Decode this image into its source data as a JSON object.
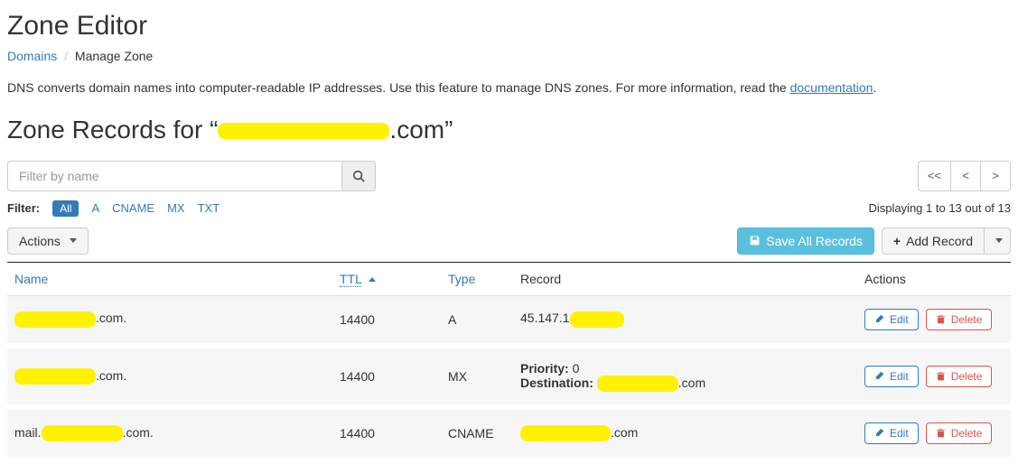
{
  "page": {
    "title": "Zone Editor",
    "breadcrumb": {
      "root": "Domains",
      "current": "Manage Zone"
    },
    "intro_pre": "DNS converts domain names into computer-readable IP addresses. Use this feature to manage DNS zones. For more information, read the ",
    "intro_link": "documentation",
    "intro_post": ".",
    "section_title_pre": "Zone Records for “",
    "section_title_post": ".com”"
  },
  "filter": {
    "placeholder": "Filter by name",
    "label": "Filter:",
    "types": {
      "all": "All",
      "a": "A",
      "cname": "CNAME",
      "mx": "MX",
      "txt": "TXT"
    },
    "active": "all"
  },
  "pagination": {
    "first": "<<",
    "prev": "<",
    "next": ">",
    "status": "Displaying 1 to 13 out of 13"
  },
  "buttons": {
    "actions": "Actions",
    "save_all": "Save All Records",
    "add_record": "Add Record",
    "edit": "Edit",
    "delete": "Delete"
  },
  "table": {
    "headers": {
      "name": "Name",
      "ttl": "TTL",
      "type": "Type",
      "record": "Record",
      "actions": "Actions"
    },
    "sort": {
      "column": "ttl",
      "dir": "asc"
    },
    "rows": [
      {
        "name_pre": "",
        "name_post": ".com.",
        "ttl": "14400",
        "type": "A",
        "record_kind": "simple",
        "record_pre": "45.147.1",
        "record_post": ""
      },
      {
        "name_pre": "",
        "name_post": ".com.",
        "ttl": "14400",
        "type": "MX",
        "record_kind": "mx",
        "priority_label": "Priority:",
        "priority": "0",
        "destination_label": "Destination:",
        "destination_post": ".com"
      },
      {
        "name_pre": "mail.",
        "name_post": ".com.",
        "ttl": "14400",
        "type": "CNAME",
        "record_kind": "simple",
        "record_pre": "",
        "record_post": ".com"
      }
    ]
  }
}
